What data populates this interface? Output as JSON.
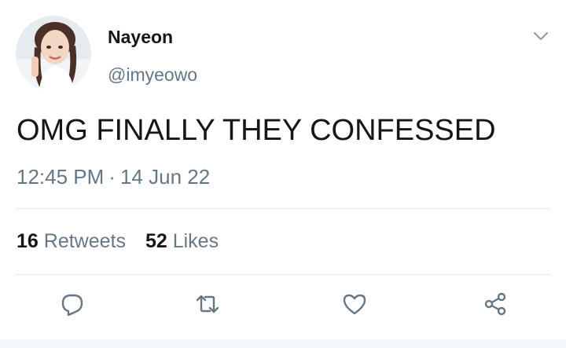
{
  "author": {
    "display_name": "Nayeon",
    "handle": "@imyeowo"
  },
  "tweet": {
    "text": "OMG FINALLY THEY CONFESSED",
    "time": "12:45 PM",
    "separator": "·",
    "date": "14 Jun 22"
  },
  "stats": {
    "retweets_count": "16",
    "retweets_label": "Retweets",
    "likes_count": "52",
    "likes_label": "Likes"
  },
  "icons": {
    "caret": "chevron-down-icon",
    "reply": "reply-icon",
    "retweet": "retweet-icon",
    "like": "heart-icon",
    "share": "share-icon"
  },
  "colors": {
    "text_primary": "#14171a",
    "text_secondary": "#657786",
    "icon": "#657786",
    "divider": "#e1e8ed"
  }
}
